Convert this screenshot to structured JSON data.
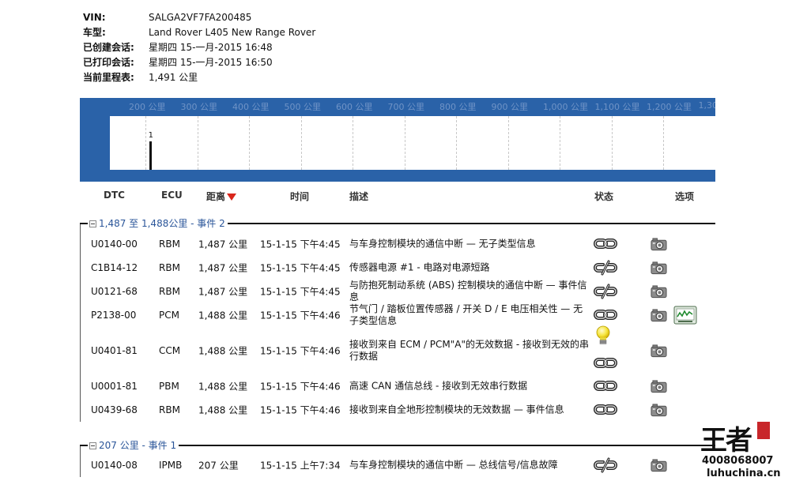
{
  "vehicle": {
    "vin_label": "VIN:",
    "vin": "SALGA2VF7FA200485",
    "model_label": "车型:",
    "model": "Land Rover L405 New Range Rover",
    "session_created_label": "已创建会话:",
    "session_created": "星期四 15-一月-2015 16:48",
    "session_printed_label": "已打印会话:",
    "session_printed": "星期四 15-一月-2015 16:50",
    "odometer_label": "当前里程表:",
    "odometer": "1,491 公里"
  },
  "timeline": {
    "axis_labels": [
      "200 公里",
      "300 公里",
      "400 公里",
      "500 公里",
      "600 公里",
      "700 公里",
      "800 公里",
      "900 公里",
      "1,000 公里",
      "1,100 公里",
      "1,200 公里",
      "1,300"
    ],
    "events": [
      {
        "km": 207,
        "count_label": "1",
        "count": 1
      }
    ],
    "colors": {
      "frame": "#2a62a8",
      "axis_text": "#6f93c6",
      "bar": "#111111"
    }
  },
  "table": {
    "headers": {
      "dtc": "DTC",
      "ecu": "ECU",
      "distance": "距离",
      "time": "时间",
      "description": "描述",
      "status": "状态",
      "options": "选项"
    },
    "sort": {
      "column": "distance",
      "direction": "desc",
      "indicator_color": "#d9261c"
    }
  },
  "groups": [
    {
      "title": "1,487 至 1,488公里 - 事件 2",
      "rows": [
        {
          "dtc": "U0140-00",
          "ecu": "RBM",
          "distance": "1,487 公里",
          "time": "15-1-15 下午4:45",
          "description": "与车身控制模块的通信中断 — 无子类型信息",
          "status_icons": [
            "chain-link-icon"
          ],
          "options": [
            "snapshot-icon"
          ]
        },
        {
          "dtc": "C1B14-12",
          "ecu": "RBM",
          "distance": "1,487 公里",
          "time": "15-1-15 下午4:45",
          "description": "传感器电源 #1 - 电路对电源短路",
          "status_icons": [
            "broken-chain-icon"
          ],
          "options": [
            "snapshot-icon"
          ]
        },
        {
          "dtc": "U0121-68",
          "ecu": "RBM",
          "distance": "1,487 公里",
          "time": "15-1-15 下午4:45",
          "description": "与防抱死制动系统 (ABS) 控制模块的通信中断 — 事件信息",
          "status_icons": [
            "broken-chain-icon"
          ],
          "options": [
            "snapshot-icon"
          ]
        },
        {
          "dtc": "P2138-00",
          "ecu": "PCM",
          "distance": "1,488 公里",
          "time": "15-1-15 下午4:46",
          "description": "节气门 / 踏板位置传感器 / 开关 D / E 电压相关性 — 无子类型信息",
          "status_icons": [
            "chain-link-icon"
          ],
          "options": [
            "snapshot-icon",
            "graph-icon"
          ]
        },
        {
          "dtc": "U0401-81",
          "ecu": "CCM",
          "distance": "1,488 公里",
          "time": "15-1-15 下午4:46",
          "description": "接收到来自 ECM / PCM\"A\"的无效数据 - 接收到无效的串行数据",
          "status_icons": [
            "light-bulb-icon",
            "chain-link-icon"
          ],
          "options": [
            "snapshot-icon"
          ]
        },
        {
          "dtc": "U0001-81",
          "ecu": "PBM",
          "distance": "1,488 公里",
          "time": "15-1-15 下午4:46",
          "description": "高速 CAN 通信总线 - 接收到无效串行数据",
          "status_icons": [
            "chain-link-icon"
          ],
          "options": [
            "snapshot-icon"
          ]
        },
        {
          "dtc": "U0439-68",
          "ecu": "RBM",
          "distance": "1,488 公里",
          "time": "15-1-15 下午4:46",
          "description": "接收到来自全地形控制模块的无效数据 — 事件信息",
          "status_icons": [
            "chain-link-icon"
          ],
          "options": [
            "snapshot-icon"
          ]
        }
      ]
    },
    {
      "title": "207 公里 - 事件 1",
      "rows": [
        {
          "dtc": "U0140-08",
          "ecu": "IPMB",
          "distance": "207 公里",
          "time": "15-1-15 上午7:34",
          "description": "与车身控制模块的通信中断 — 总线信号/信息故障",
          "status_icons": [
            "broken-chain-icon"
          ],
          "options": [
            "snapshot-icon"
          ]
        }
      ]
    }
  ],
  "branding": {
    "title": "王者",
    "phone": "4008068007",
    "url": "luhuchina.cn",
    "seal_color": "#c8262a"
  }
}
